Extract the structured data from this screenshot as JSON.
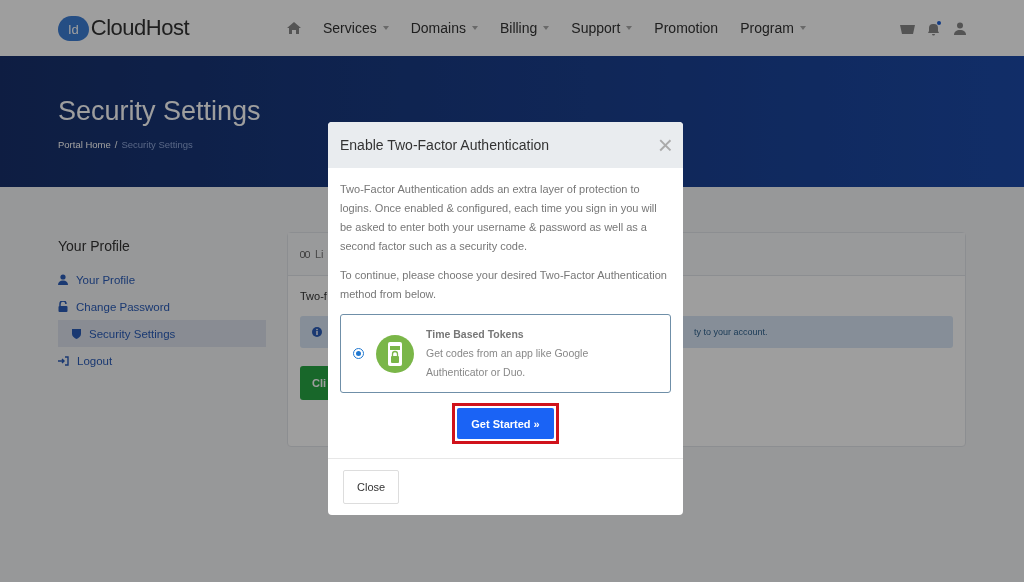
{
  "brand": {
    "badge": "Id",
    "name": "CloudHost"
  },
  "nav": [
    {
      "label": "Services",
      "has_menu": true
    },
    {
      "label": "Domains",
      "has_menu": true
    },
    {
      "label": "Billing",
      "has_menu": true
    },
    {
      "label": "Support",
      "has_menu": true
    },
    {
      "label": "Promotion",
      "has_menu": false
    },
    {
      "label": "Program",
      "has_menu": true
    }
  ],
  "notifications": {
    "unread": true
  },
  "banner": {
    "title": "Security Settings",
    "separator": "/",
    "breadcrumb": [
      {
        "label": "Portal Home",
        "selected": false
      },
      {
        "label": "Security Settings",
        "selected": true
      }
    ]
  },
  "sidebar": {
    "title": "Your Profile",
    "items": [
      {
        "label": "Your Profile",
        "kind": "user",
        "selected": false
      },
      {
        "label": "Change Password",
        "kind": "lock",
        "selected": false
      },
      {
        "label": "Security Settings",
        "kind": "shield",
        "selected": true
      },
      {
        "label": "Logout",
        "kind": "logout",
        "selected": false
      }
    ]
  },
  "card": {
    "tab": "Li",
    "text": "Two-f",
    "alert": "ty to your account.",
    "button": "Cli"
  },
  "modal": {
    "title": "Enable Two-Factor Authentication",
    "close": "×",
    "paragraphs": [
      "Two-Factor Authentication adds an extra layer of protection to logins. Once enabled & configured, each time you sign in you will be asked to enter both your username & password as well as a second factor such as a security code.",
      "To continue, please choose your desired Two-Factor Authentication method from below."
    ],
    "methods": [
      {
        "title": "Time Based Tokens",
        "description": "Get codes from an app like Google Authenticator or Duo.",
        "selected": true
      }
    ],
    "primary": {
      "label": "Get Started »",
      "highlighted": true
    },
    "footer_button": "Close"
  }
}
